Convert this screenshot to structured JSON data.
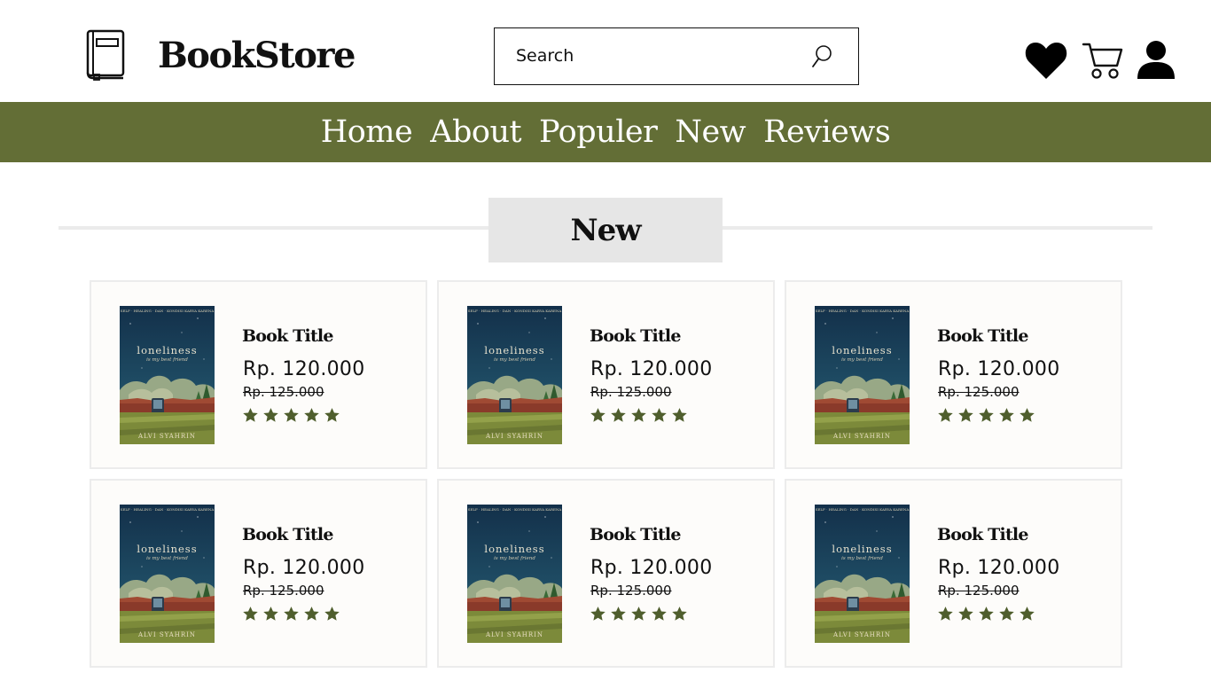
{
  "header": {
    "brand": "BookStore",
    "search_placeholder": "Search"
  },
  "icons": {
    "logo": "book-icon",
    "search": "search-icon",
    "wishlist": "heart-icon",
    "cart": "cart-icon",
    "account": "user-icon"
  },
  "nav": {
    "items": [
      "Home",
      "About",
      "Populer",
      "New",
      "Reviews"
    ]
  },
  "section": {
    "title": "New"
  },
  "colors": {
    "accent": "#636e36",
    "star": "#4f5e2d",
    "card_bg": "#fdfcfa",
    "section_bg": "#e6e6e6"
  },
  "cover": {
    "top_text": "SELF · HEALING · DAN · KONDISI KARYA KARENA",
    "title": "loneliness",
    "subtitle": "is my best friend",
    "author": "ALVI SYAHRIN"
  },
  "products": [
    {
      "title": "Book Title",
      "price": "Rp. 120.000",
      "old_price": "Rp. 125.000",
      "rating": 5
    },
    {
      "title": "Book Title",
      "price": "Rp. 120.000",
      "old_price": "Rp. 125.000",
      "rating": 5
    },
    {
      "title": "Book Title",
      "price": "Rp. 120.000",
      "old_price": "Rp. 125.000",
      "rating": 5
    },
    {
      "title": "Book Title",
      "price": "Rp. 120.000",
      "old_price": "Rp. 125.000",
      "rating": 5
    },
    {
      "title": "Book Title",
      "price": "Rp. 120.000",
      "old_price": "Rp. 125.000",
      "rating": 5
    },
    {
      "title": "Book Title",
      "price": "Rp. 120.000",
      "old_price": "Rp. 125.000",
      "rating": 5
    }
  ]
}
